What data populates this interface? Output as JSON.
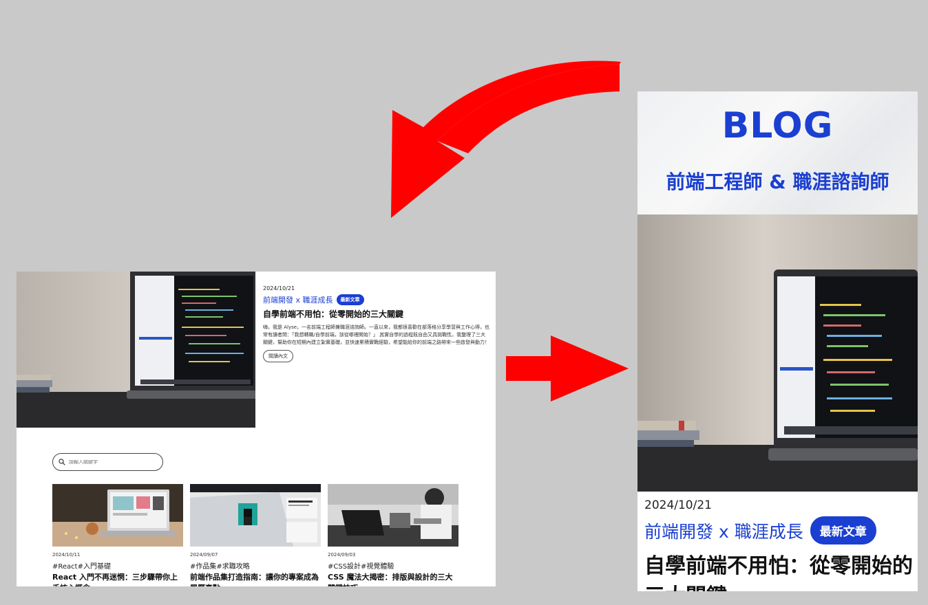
{
  "colors": {
    "accent": "#1a3fd1",
    "arrow": "#ff0000",
    "background": "#c9c9c9"
  },
  "desktop": {
    "hero": {
      "date": "2024/10/21",
      "category": "前端開發 x 職涯成長",
      "badge": "最新文章",
      "title": "自學前端不用怕：從零開始的三大關鍵",
      "excerpt": "嗨，我是 Alyse，一名前端工程師兼職涯諮詢師。一直以來，我都很喜歡在部落格分享學習與工作心得，也常有讀者問：「我想轉職/自學前端，該從哪裡開始？」 其實自學的過程既自由又具挑戰性。我整理了三大關鍵，幫助你在短期內建立紮實基礎，並快速累積實戰經驗，希望能給你的前端之路帶來一些啟發與動力！",
      "read_more": "閱讀內文"
    },
    "search": {
      "placeholder": "請輸入關鍵字"
    },
    "cards": [
      {
        "date": "2024/10/11",
        "tags": "#React#入門基礎",
        "title": "React 入門不再迷惘：三步驟帶你上手核心概念"
      },
      {
        "date": "2024/09/07",
        "tags": "#作品集#求職攻略",
        "title": "前端作品集打造指南：讓你的專案成為履歷亮點"
      },
      {
        "date": "2024/09/03",
        "tags": "#CSS設計#視覺體驗",
        "title": "CSS 魔法大揭密：排版與設計的三大關鍵技巧"
      }
    ]
  },
  "mobile": {
    "banner_title": "BLOG",
    "banner_subtitle": "前端工程師 & 職涯諮詢師",
    "date": "2024/10/21",
    "category": "前端開發 x 職涯成長",
    "badge": "最新文章",
    "title": "自學前端不用怕：從零開始的三大關鍵"
  }
}
